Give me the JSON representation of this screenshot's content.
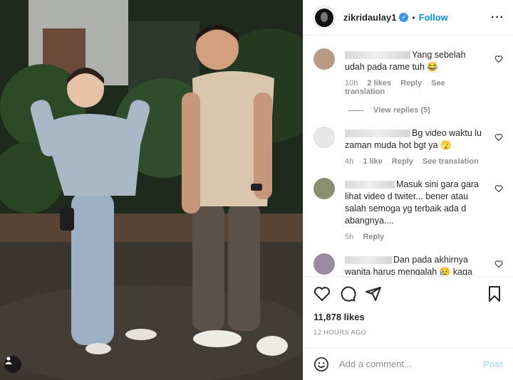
{
  "post": {
    "username": "zikridaulay1",
    "follow_label": "Follow",
    "separator": "•",
    "more_label": "···",
    "likes": "11,878 likes",
    "time_ago": "12 HOURS AGO"
  },
  "comments": [
    {
      "text": "Yang sebelah udah pada rame tuh 😂",
      "time": "10h",
      "likes": "2 likes",
      "reply": "Reply",
      "translate": "See translation",
      "view_replies": "View replies (5)",
      "avatar_color": "#b99a85"
    },
    {
      "text": "Bg video waktu lu zaman muda hot bgt ya 🫣",
      "time": "4h",
      "likes": "1 like",
      "reply": "Reply",
      "translate": "See translation",
      "avatar_color": "#dbdbdb"
    },
    {
      "text": "Masuk sini gara gara lihat video d twiter... bener atau salah semoga yg terbaik ada d abangnya....",
      "time": "5h",
      "reply": "Reply",
      "avatar_color": "#8a8f70"
    },
    {
      "text": "Dan pada akhirnya wanita harus mengalah 😥 kaga",
      "avatar_color": "#9b8aa0"
    }
  ],
  "add_comment": {
    "placeholder": "Add a comment...",
    "post_label": "Post"
  },
  "icons": {
    "heart": "heart-icon",
    "comment": "comment-icon",
    "share": "share-icon",
    "bookmark": "bookmark-icon",
    "emoji": "emoji-icon",
    "verified": "verified-icon",
    "user_tag": "user-tag-icon"
  },
  "colors": {
    "accent": "#0095f6",
    "verified": "#3897f0",
    "muted": "#8e8e8e",
    "post_disabled": "#b2dffc"
  }
}
